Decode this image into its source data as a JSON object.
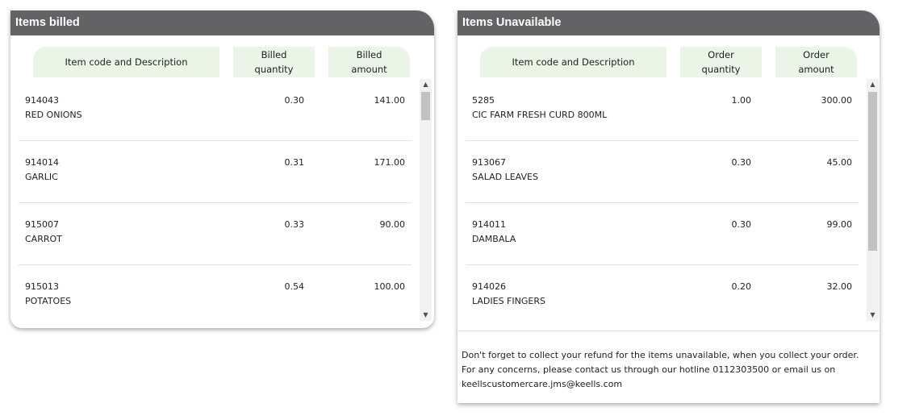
{
  "billed": {
    "title": "Items billed",
    "headers": {
      "description": "Item code and Description",
      "quantity": "Billed\nquantity",
      "amount": "Billed\namount"
    },
    "rows": [
      {
        "code": "914043",
        "description": "RED ONIONS",
        "quantity": "0.30",
        "amount": "141.00"
      },
      {
        "code": "914014",
        "description": "GARLIC",
        "quantity": "0.31",
        "amount": "171.00"
      },
      {
        "code": "915007",
        "description": "CARROT",
        "quantity": "0.33",
        "amount": "90.00"
      },
      {
        "code": "915013",
        "description": "POTATOES",
        "quantity": "0.54",
        "amount": "100.00"
      }
    ]
  },
  "unavailable": {
    "title": "Items Unavailable",
    "headers": {
      "description": "Item code and Description",
      "quantity": "Order\nquantity",
      "amount": "Order\namount"
    },
    "rows": [
      {
        "code": "5285",
        "description": "CIC FARM FRESH CURD 800ML",
        "quantity": "1.00",
        "amount": "300.00"
      },
      {
        "code": "913067",
        "description": "SALAD LEAVES",
        "quantity": "0.30",
        "amount": "45.00"
      },
      {
        "code": "914011",
        "description": "DAMBALA",
        "quantity": "0.30",
        "amount": "99.00"
      },
      {
        "code": "914026",
        "description": "LADIES FINGERS",
        "quantity": "0.20",
        "amount": "32.00"
      }
    ],
    "note": "Don't forget to collect your refund for the items unavailable, when you collect your order. For any concerns, please contact us through our hotline 0112303500 or email us on keellscustomercare.jms@keells.com"
  },
  "icons": {
    "scroll_up": "triangle-up-icon",
    "scroll_down": "triangle-down-icon"
  },
  "colors": {
    "header_bg": "#636366",
    "column_header_bg": "#eaf5e7"
  }
}
